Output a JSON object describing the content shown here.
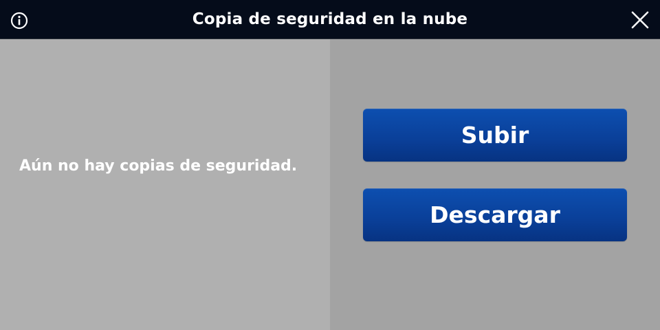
{
  "header": {
    "title": "Copia de seguridad en la nube",
    "info_icon": "info-circle-icon",
    "close_icon": "close-x-icon"
  },
  "backup_list": {
    "empty_message": "Aún no hay copias de seguridad."
  },
  "actions": {
    "upload_label": "Subir",
    "download_label": "Descargar"
  },
  "colors": {
    "titlebar": "#050c1a",
    "left_panel": "#b0b0b0",
    "right_panel": "#a3a3a3",
    "button": "#0a3f98",
    "text": "#ffffff"
  }
}
